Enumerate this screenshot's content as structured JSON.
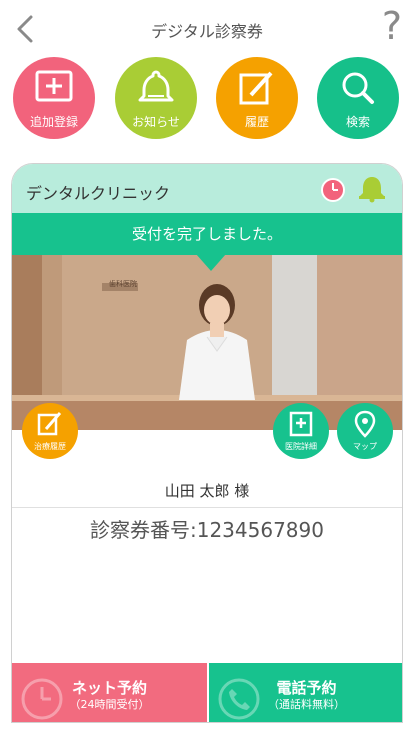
{
  "header": {
    "title": "デジタル診察券",
    "back_icon": "chevron-left-icon",
    "help_label": "?"
  },
  "quick_actions": [
    {
      "label": "追加登録",
      "icon": "plus-square-icon",
      "color": "#f2637c"
    },
    {
      "label": "お知らせ",
      "icon": "bell-icon",
      "color": "#a9cd35"
    },
    {
      "label": "履歴",
      "icon": "edit-icon",
      "color": "#f5a100"
    },
    {
      "label": "検索",
      "icon": "search-icon",
      "color": "#16c08a"
    }
  ],
  "card": {
    "clinic_name": "デンタルクリニック",
    "banner": "受付を完了しました。",
    "photo_sign": "歯科医院",
    "fabs": {
      "treatment_history": "治療履歴",
      "clinic_detail": "医院詳細",
      "map": "マップ"
    },
    "patient_name": "山田 太郎 様",
    "ticket_number": "診察券番号:1234567890",
    "buttons": {
      "net_reserve": {
        "label": "ネット予約",
        "sub": "（24時間受付）"
      },
      "tel_reserve": {
        "label": "電話予約",
        "sub": "（通話料無料）"
      }
    }
  },
  "colors": {
    "accent_green": "#17c28e",
    "header_mint": "#b8ecdc",
    "pink": "#f2637c",
    "orange": "#f5a100",
    "lime": "#a9cd35"
  }
}
